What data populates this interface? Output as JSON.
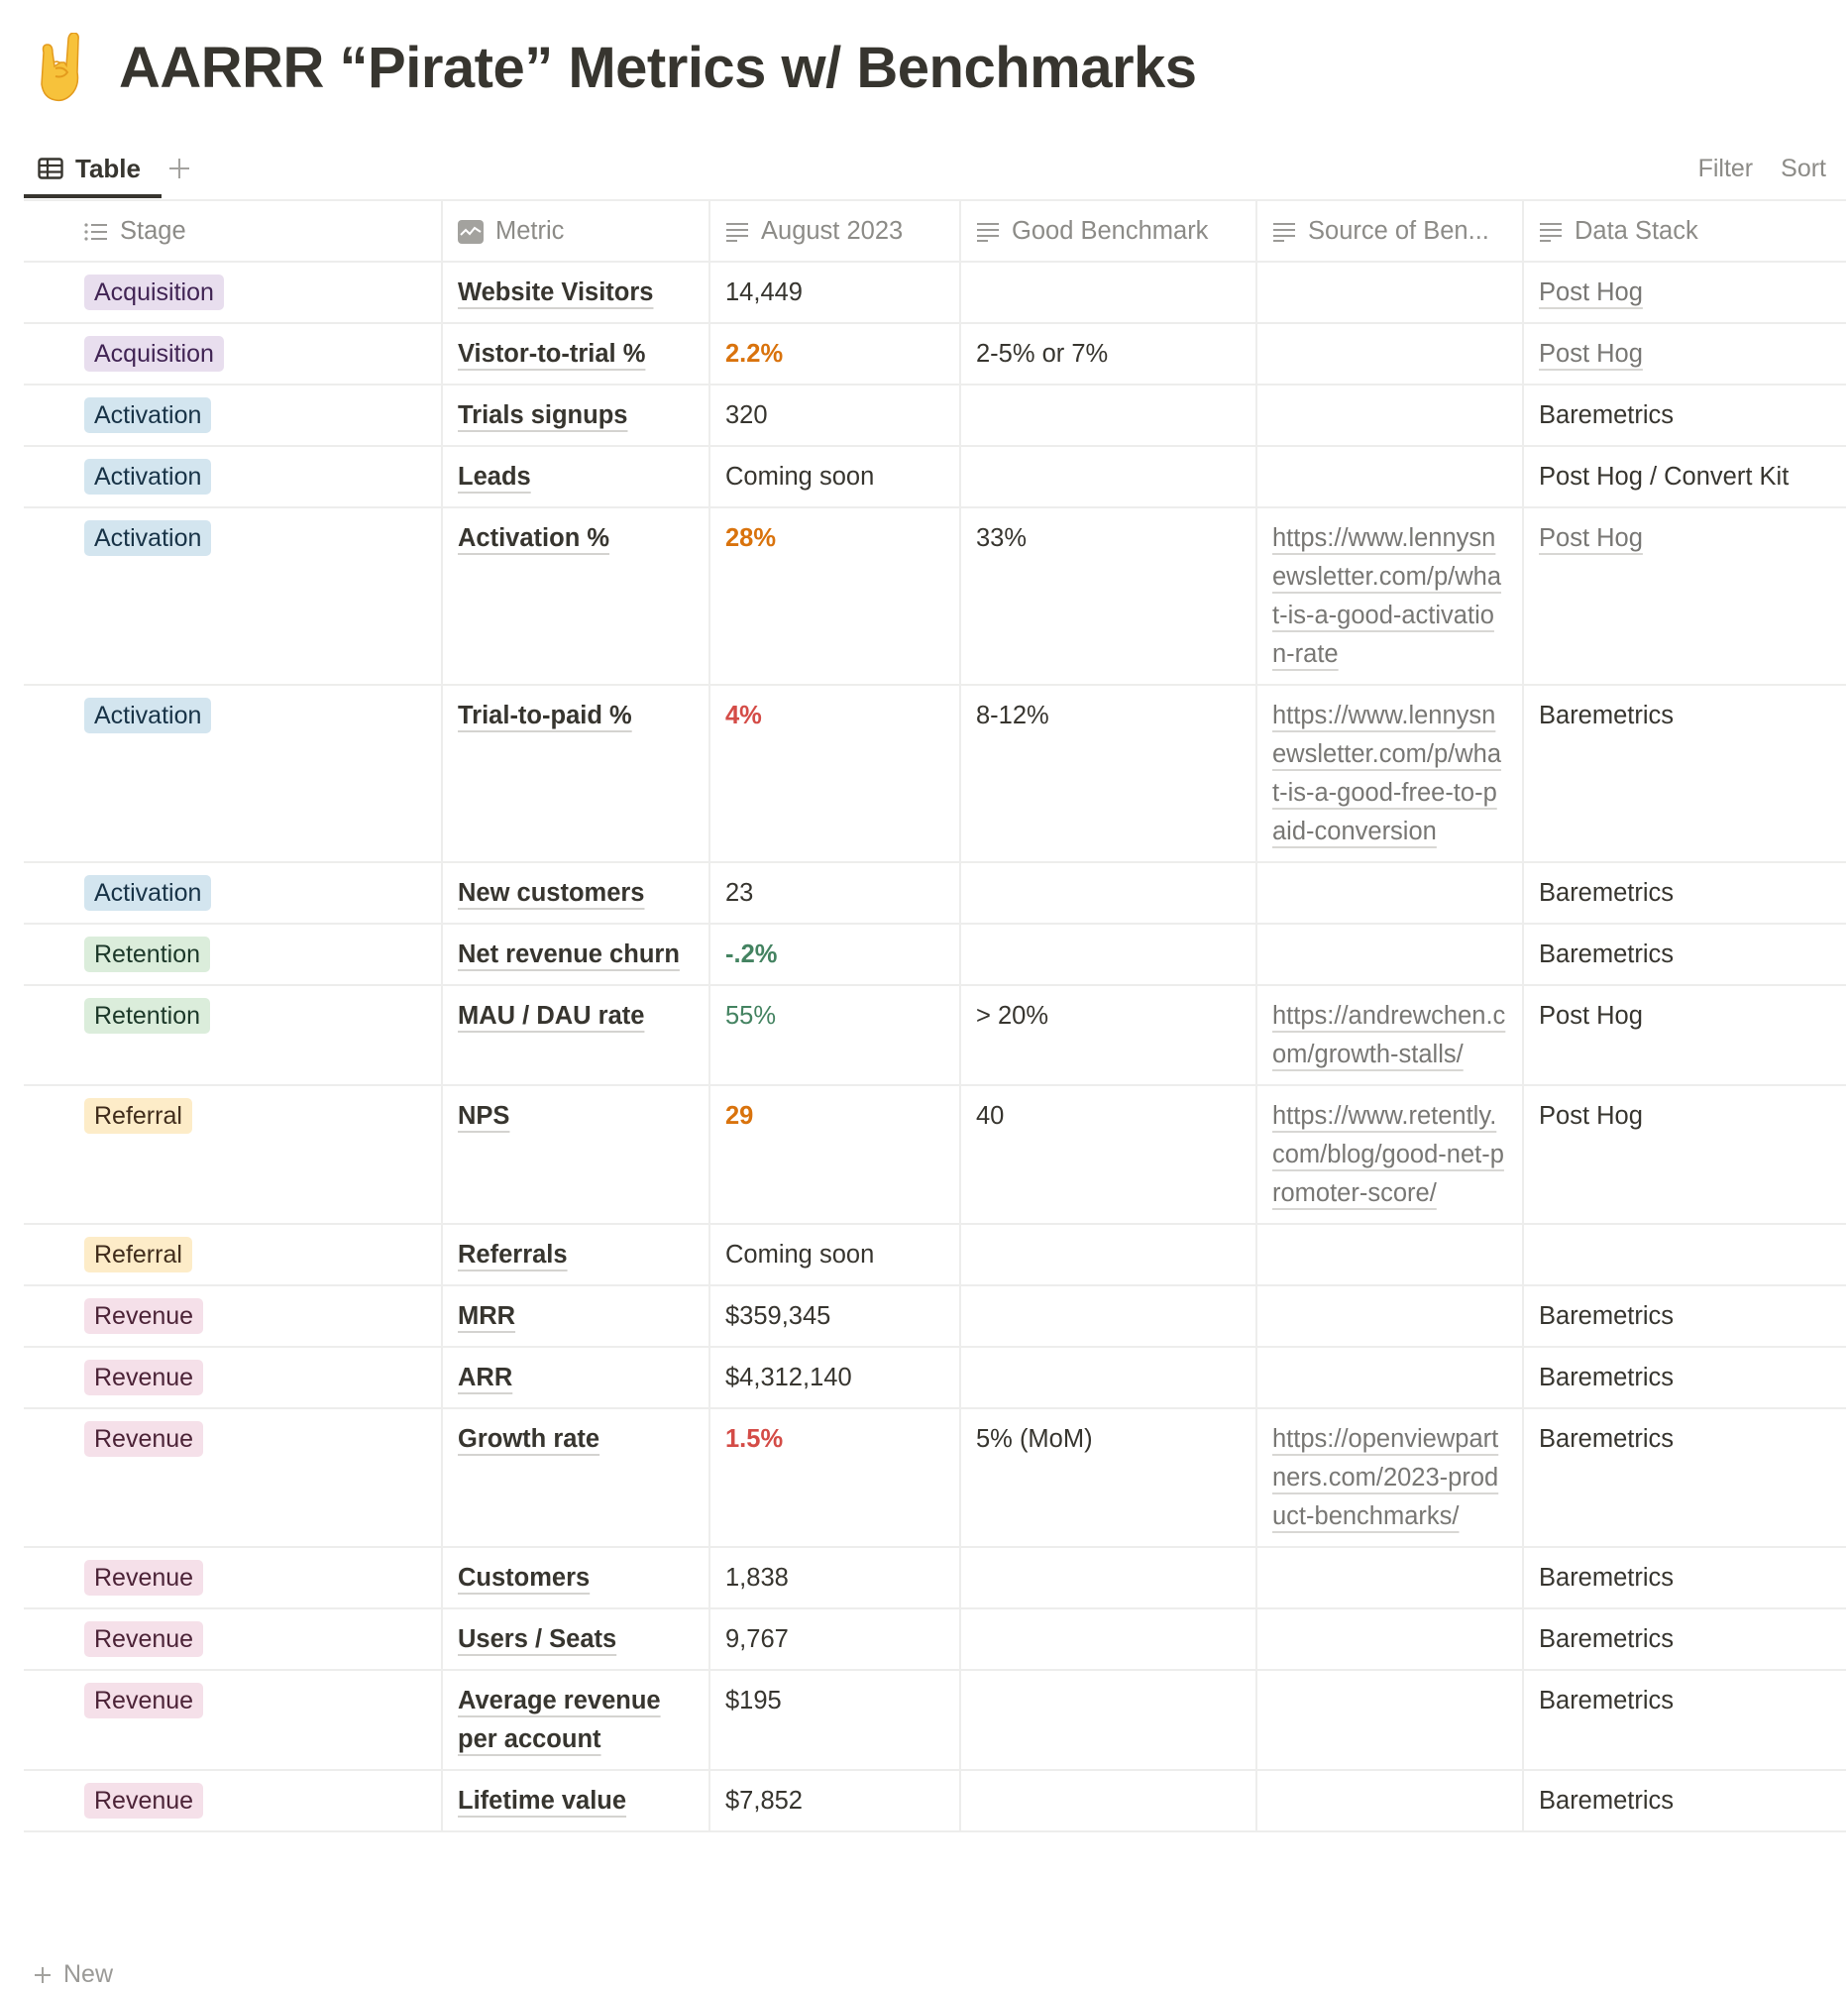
{
  "page": {
    "icon": "sign-of-the-horns-emoji",
    "title": "AARRR “Pirate” Metrics w/ Benchmarks"
  },
  "viewbar": {
    "tab_label": "Table",
    "add_view_label": "+",
    "filter_label": "Filter",
    "sort_label": "Sort"
  },
  "colors": {
    "acquisition_bg": "#e8deee",
    "acquisition_fg": "#412454",
    "activation_bg": "#d3e5ef",
    "activation_fg": "#183347",
    "retention_bg": "#dbeddb",
    "retention_fg": "#1c3829",
    "referral_bg": "#fdecc8",
    "referral_fg": "#402c1b",
    "revenue_bg": "#f5e0e9",
    "revenue_fg": "#4c2337",
    "orange": "#d9730d",
    "red": "#d44c47",
    "green": "#448361"
  },
  "table": {
    "columns": [
      {
        "label": "Stage",
        "icon": "list-icon"
      },
      {
        "label": "Metric",
        "icon": "chart-title-icon"
      },
      {
        "label": "August 2023",
        "icon": "text-icon"
      },
      {
        "label": "Good Benchmark",
        "icon": "text-icon"
      },
      {
        "label": "Source of Ben...",
        "icon": "text-icon"
      },
      {
        "label": "Data Stack",
        "icon": "text-icon"
      }
    ],
    "rows": [
      {
        "stage": "Acquisition",
        "metric": "Website Visitors",
        "value": "14,449",
        "value_style": "plain",
        "benchmark": "",
        "source": "",
        "stack": "Post Hog",
        "stack_link": true
      },
      {
        "stage": "Acquisition",
        "metric": "Vistor-to-trial %",
        "value": "2.2%",
        "value_style": "orange",
        "benchmark": "2-5% or 7%",
        "source": "",
        "stack": "Post Hog",
        "stack_link": true
      },
      {
        "stage": "Activation",
        "metric": "Trials signups",
        "value": "320",
        "value_style": "plain",
        "benchmark": "",
        "source": "",
        "stack": "Baremetrics",
        "stack_link": false
      },
      {
        "stage": "Activation",
        "metric": "Leads",
        "value": "Coming soon",
        "value_style": "plain",
        "benchmark": "",
        "source": "",
        "stack": "Post Hog / Convert Kit",
        "stack_link": false
      },
      {
        "stage": "Activation",
        "metric": "Activation %",
        "value": "28%",
        "value_style": "orange",
        "benchmark": "33%",
        "source": "https://www.lennysnewsletter.com/p/what-is-a-good-activation-rate",
        "stack": "Post Hog",
        "stack_link": true
      },
      {
        "stage": "Activation",
        "metric": "Trial-to-paid %",
        "value": "4%",
        "value_style": "red",
        "benchmark": "8-12%",
        "source": "https://www.lennysnewsletter.com/p/what-is-a-good-free-to-paid-conversion",
        "stack": "Baremetrics",
        "stack_link": false
      },
      {
        "stage": "Activation",
        "metric": "New customers",
        "value": "23",
        "value_style": "plain",
        "benchmark": "",
        "source": "",
        "stack": "Baremetrics",
        "stack_link": false
      },
      {
        "stage": "Retention",
        "metric": "Net revenue churn",
        "value": "-.2%",
        "value_style": "green-bold",
        "benchmark": "",
        "source": "",
        "stack": "Baremetrics",
        "stack_link": false
      },
      {
        "stage": "Retention",
        "metric": "MAU / DAU rate",
        "value": "55%",
        "value_style": "green",
        "benchmark": "> 20%",
        "source": "https://andrewchen.com/growth-stalls/",
        "stack": "Post Hog",
        "stack_link": false
      },
      {
        "stage": "Referral",
        "metric": "NPS",
        "value": "29",
        "value_style": "orange",
        "benchmark": "40",
        "source": "https://www.retently.com/blog/good-net-promoter-score/",
        "stack": "Post Hog",
        "stack_link": false
      },
      {
        "stage": "Referral",
        "metric": "Referrals",
        "value": "Coming soon",
        "value_style": "plain",
        "benchmark": "",
        "source": "",
        "stack": "",
        "stack_link": false
      },
      {
        "stage": "Revenue",
        "metric": "MRR",
        "value": "$359,345",
        "value_style": "plain",
        "benchmark": "",
        "source": "",
        "stack": "Baremetrics",
        "stack_link": false
      },
      {
        "stage": "Revenue",
        "metric": "ARR",
        "value": "$4,312,140",
        "value_style": "plain",
        "benchmark": "",
        "source": "",
        "stack": "Baremetrics",
        "stack_link": false
      },
      {
        "stage": "Revenue",
        "metric": "Growth rate",
        "value": "1.5%",
        "value_style": "red",
        "benchmark": "5% (MoM)",
        "source": "https://openviewpartners.com/2023-product-benchmarks/",
        "stack": "Baremetrics",
        "stack_link": false
      },
      {
        "stage": "Revenue",
        "metric": "Customers",
        "value": "1,838",
        "value_style": "plain",
        "benchmark": "",
        "source": "",
        "stack": "Baremetrics",
        "stack_link": false
      },
      {
        "stage": "Revenue",
        "metric": "Users / Seats",
        "value": "9,767",
        "value_style": "plain",
        "benchmark": "",
        "source": "",
        "stack": "Baremetrics",
        "stack_link": false
      },
      {
        "stage": "Revenue",
        "metric": "Average revenue per account",
        "value": "$195",
        "value_style": "plain",
        "benchmark": "",
        "source": "",
        "stack": "Baremetrics",
        "stack_link": false
      },
      {
        "stage": "Revenue",
        "metric": "Lifetime value",
        "value": "$7,852",
        "value_style": "plain",
        "benchmark": "",
        "source": "",
        "stack": "Baremetrics",
        "stack_link": false
      }
    ],
    "new_row_label": "New"
  }
}
